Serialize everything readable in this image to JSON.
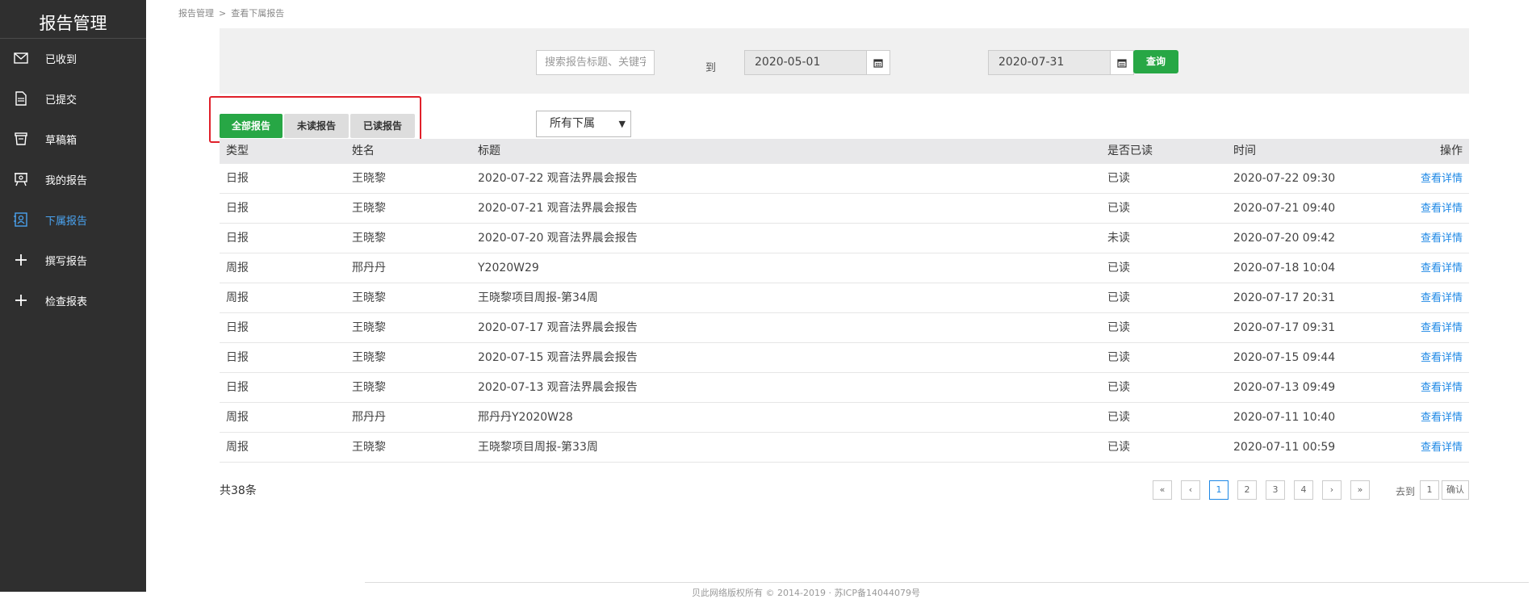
{
  "sidebar": {
    "title": "报告管理",
    "items": [
      {
        "label": "已收到",
        "icon": "mail-icon"
      },
      {
        "label": "已提交",
        "icon": "document-icon"
      },
      {
        "label": "草稿箱",
        "icon": "inbox-icon"
      },
      {
        "label": "我的报告",
        "icon": "presentation-icon"
      },
      {
        "label": "下属报告",
        "icon": "contact-card-icon",
        "active": true
      },
      {
        "label": "撰写报告",
        "icon": "plus-icon"
      },
      {
        "label": "检查报表",
        "icon": "plus-icon"
      }
    ]
  },
  "breadcrumb": {
    "root": "报告管理",
    "separator": ">",
    "current": "查看下属报告"
  },
  "filters": {
    "search_placeholder": "搜索报告标题、关键字",
    "date_from": "2020-05-01",
    "to_label": "到",
    "date_to": "2020-07-31",
    "query_label": "查询"
  },
  "tabs": {
    "all": "全部报告",
    "unread": "未读报告",
    "read": "已读报告"
  },
  "subordinate_select": {
    "selected": "所有下属"
  },
  "table": {
    "headers": [
      "类型",
      "姓名",
      "标题",
      "是否已读",
      "时间",
      "操作"
    ],
    "rows": [
      {
        "type": "日报",
        "name": "王晓黎",
        "title": "2020-07-22 观音法界晨会报告",
        "read": "已读",
        "time": "2020-07-22 09:30",
        "action": "查看详情"
      },
      {
        "type": "日报",
        "name": "王晓黎",
        "title": "2020-07-21 观音法界晨会报告",
        "read": "已读",
        "time": "2020-07-21 09:40",
        "action": "查看详情"
      },
      {
        "type": "日报",
        "name": "王晓黎",
        "title": "2020-07-20 观音法界晨会报告",
        "read": "未读",
        "time": "2020-07-20 09:42",
        "action": "查看详情"
      },
      {
        "type": "周报",
        "name": "邢丹丹",
        "title": "Y2020W29",
        "read": "已读",
        "time": "2020-07-18 10:04",
        "action": "查看详情"
      },
      {
        "type": "周报",
        "name": "王晓黎",
        "title": "王晓黎项目周报-第34周",
        "read": "已读",
        "time": "2020-07-17 20:31",
        "action": "查看详情"
      },
      {
        "type": "日报",
        "name": "王晓黎",
        "title": "2020-07-17 观音法界晨会报告",
        "read": "已读",
        "time": "2020-07-17 09:31",
        "action": "查看详情"
      },
      {
        "type": "日报",
        "name": "王晓黎",
        "title": "2020-07-15 观音法界晨会报告",
        "read": "已读",
        "time": "2020-07-15 09:44",
        "action": "查看详情"
      },
      {
        "type": "日报",
        "name": "王晓黎",
        "title": "2020-07-13 观音法界晨会报告",
        "read": "已读",
        "time": "2020-07-13 09:49",
        "action": "查看详情"
      },
      {
        "type": "周报",
        "name": "邢丹丹",
        "title": "邢丹丹Y2020W28",
        "read": "已读",
        "time": "2020-07-11 10:40",
        "action": "查看详情"
      },
      {
        "type": "周报",
        "name": "王晓黎",
        "title": "王晓黎项目周报-第33周",
        "read": "已读",
        "time": "2020-07-11 00:59",
        "action": "查看详情"
      }
    ]
  },
  "summary": {
    "total": "共38条"
  },
  "pagination": {
    "first": "«",
    "prev": "‹",
    "pages": [
      "1",
      "2",
      "3",
      "4"
    ],
    "current": "1",
    "next": "›",
    "last": "»",
    "goto_label": "去到",
    "goto_value": "1",
    "confirm_label": "确认"
  },
  "footer": {
    "text": "贝此网络版权所有 © 2014-2019 · 苏ICP备14044079号"
  },
  "colors": {
    "sidebar_bg": "#2f2f2f",
    "accent_green": "#27a745",
    "active_blue": "#4aa3f0",
    "link_blue": "#1e88e5",
    "highlight_red": "#e0202a"
  }
}
